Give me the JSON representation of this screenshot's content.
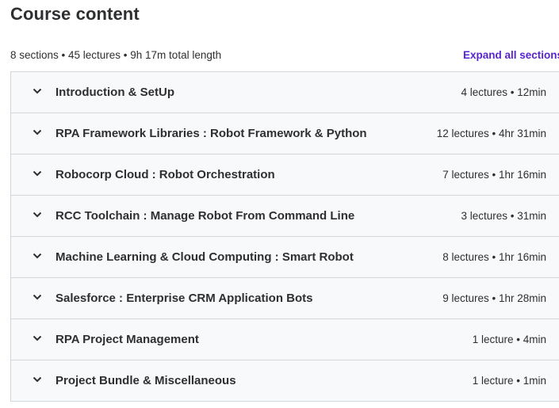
{
  "header": {
    "title": "Course content",
    "summary": "8 sections • 45 lectures • 9h 17m total length",
    "expand_label": "Expand all sections"
  },
  "sections": [
    {
      "title": "Introduction & SetUp",
      "info": "4 lectures • 12min"
    },
    {
      "title": "RPA Framework Libraries : Robot Framework & Python",
      "info": "12 lectures • 4hr 31min"
    },
    {
      "title": "Robocorp Cloud : Robot Orchestration",
      "info": "7 lectures • 1hr 16min"
    },
    {
      "title": "RCC Toolchain : Manage Robot From Command Line",
      "info": "3 lectures • 31min"
    },
    {
      "title": "Machine Learning & Cloud Computing : Smart Robot",
      "info": "8 lectures • 1hr 16min"
    },
    {
      "title": "Salesforce : Enterprise CRM Application Bots",
      "info": "9 lectures • 1hr 28min"
    },
    {
      "title": "RPA Project Management",
      "info": "1 lecture • 4min"
    },
    {
      "title": "Project Bundle & Miscellaneous",
      "info": "1 lecture • 1min"
    }
  ],
  "icons": {
    "section_toggle": "chevron-down-icon"
  },
  "colors": {
    "accent": "#5624d0",
    "row_bg": "#f7f9fa",
    "border": "#d1d7dc"
  }
}
